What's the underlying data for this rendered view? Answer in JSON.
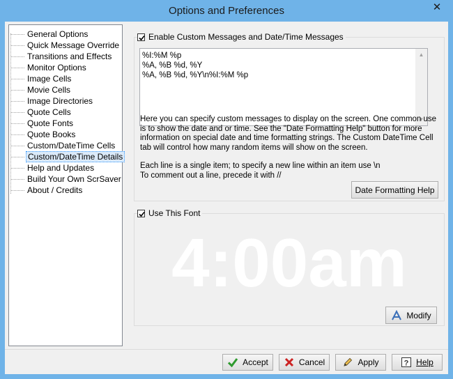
{
  "window": {
    "title": "Options and Preferences",
    "close_glyph": "✕"
  },
  "tree": {
    "items": [
      {
        "label": "General Options"
      },
      {
        "label": "Quick Message Override"
      },
      {
        "label": "Transitions and Effects"
      },
      {
        "label": "Monitor Options"
      },
      {
        "label": "Image Cells"
      },
      {
        "label": "Movie Cells"
      },
      {
        "label": "Image Directories"
      },
      {
        "label": "Quote Cells"
      },
      {
        "label": "Quote Fonts"
      },
      {
        "label": "Quote Books"
      },
      {
        "label": "Custom/DateTime Cells"
      },
      {
        "label": "Custom/DateTime Details",
        "selected": true
      },
      {
        "label": "Help and Updates"
      },
      {
        "label": "Build Your Own ScrSaver"
      },
      {
        "label": "About / Credits"
      }
    ]
  },
  "custom_messages": {
    "checkbox_label": "Enable Custom Messages and Date/Time Messages",
    "checked": true,
    "lines": [
      "%I:%M %p",
      "%A, %B %d, %Y",
      "%A, %B %d, %Y\\n%I:%M %p"
    ],
    "help_paragraph1": "Here you can specify custom messages to display on the screen. One common use is to show the date and or time.  See the \"Date Formatting Help\" button for more information on special date and time formatting strings. The Custom DateTime Cell tab will control how many random items will show on the screen.",
    "help_line2": "Each line is a single item; to specify a new line within an item use \\n",
    "help_line3": "To comment out a line, precede it with //",
    "date_help_button": "Date Formatting Help"
  },
  "font": {
    "checkbox_label": "Use This Font",
    "checked": true,
    "preview_text": "4:00am",
    "modify_button": "Modify"
  },
  "footer": {
    "accept": "Accept",
    "cancel": "Cancel",
    "apply": "Apply",
    "help": "Help"
  },
  "colors": {
    "frame": "#6fb3e8",
    "accept_icon": "#2e9a2e",
    "cancel_icon": "#cc2222"
  }
}
